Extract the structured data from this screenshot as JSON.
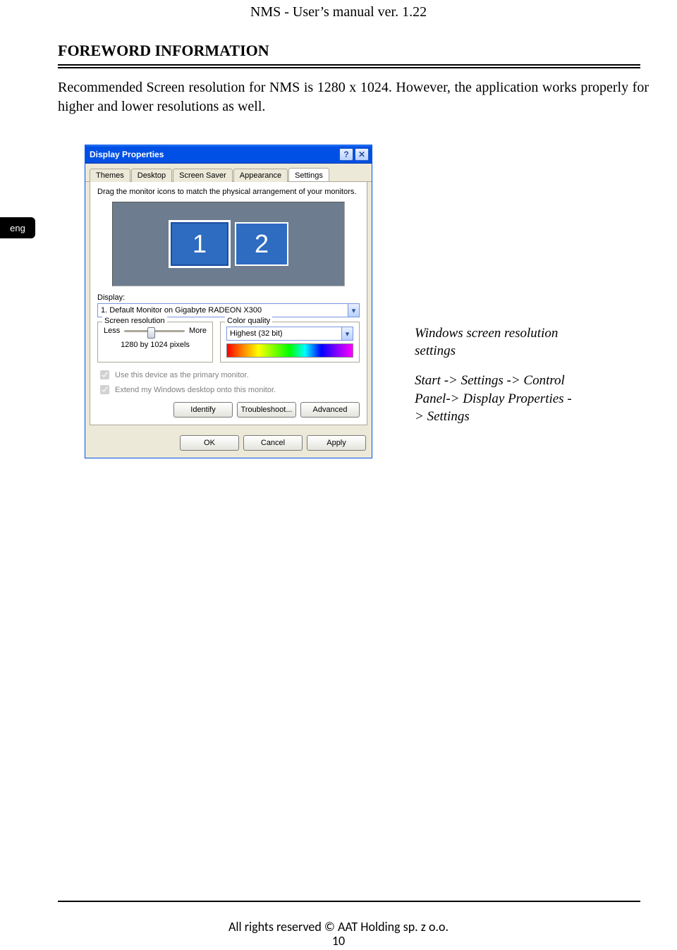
{
  "header": {
    "title": "NMS - User’s manual ver. 1.22"
  },
  "section": {
    "title": "FOREWORD INFORMATION"
  },
  "body": {
    "paragraph": "Recommended Screen resolution for NMS is 1280 x 1024. However, the application works properly for higher and lower resolutions as well."
  },
  "language_tab": "eng",
  "dialog": {
    "title": "Display Properties",
    "help_glyph": "?",
    "close_glyph": "✕",
    "tabs": [
      "Themes",
      "Desktop",
      "Screen Saver",
      "Appearance",
      "Settings"
    ],
    "active_tab_index": 4,
    "hint": "Drag the monitor icons to match the physical arrangement of your monitors.",
    "monitors": [
      "1",
      "2"
    ],
    "display_label": "Display:",
    "display_value": "1. Default Monitor on Gigabyte RADEON X300",
    "screen_res": {
      "title": "Screen resolution",
      "less": "Less",
      "more": "More",
      "readout": "1280 by 1024 pixels"
    },
    "color_quality": {
      "title": "Color quality",
      "value": "Highest (32 bit)"
    },
    "checks": {
      "primary": "Use this device as the primary monitor.",
      "extend": "Extend my Windows desktop onto this monitor."
    },
    "buttons": {
      "identify": "Identify",
      "troubleshoot": "Troubleshoot...",
      "advanced": "Advanced",
      "ok": "OK",
      "cancel": "Cancel",
      "apply": "Apply"
    }
  },
  "caption": {
    "line1": "Windows screen resolution settings",
    "line2": "Start -> Settings -> Control Panel-> Display Properties -> Settings"
  },
  "footer": {
    "copyright": "All rights reserved © AAT Holding sp. z o.o.",
    "page": "10"
  }
}
